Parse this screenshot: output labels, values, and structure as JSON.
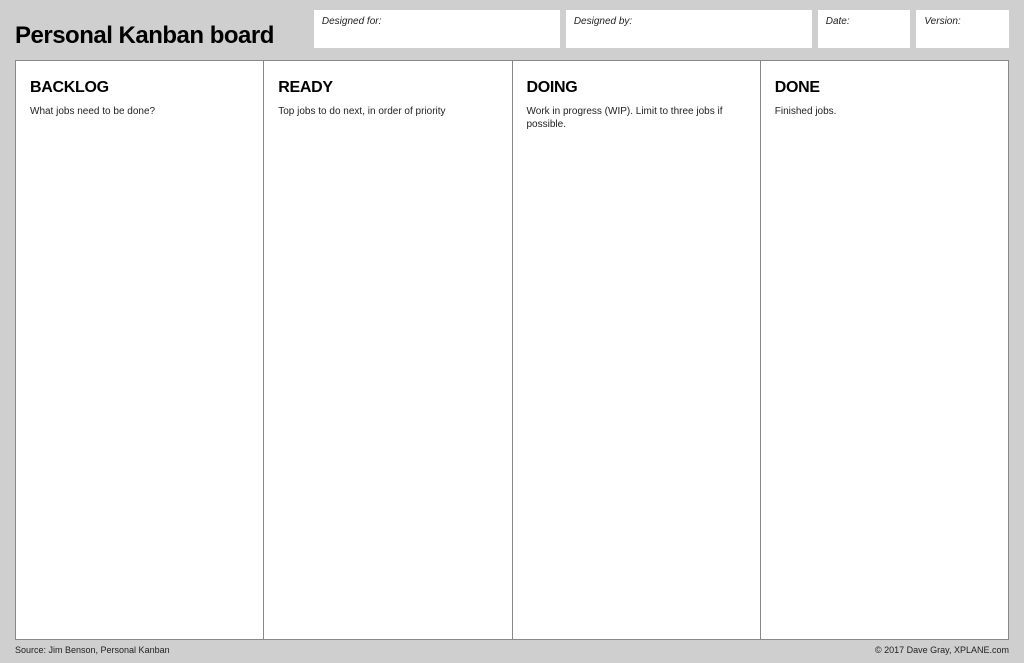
{
  "title": "Personal Kanban board",
  "meta": {
    "designed_for": {
      "label": "Designed for:"
    },
    "designed_by": {
      "label": "Designed by:"
    },
    "date": {
      "label": "Date:"
    },
    "version": {
      "label": "Version:"
    }
  },
  "columns": [
    {
      "title": "BACKLOG",
      "desc": "What jobs need to be done?"
    },
    {
      "title": "READY",
      "desc": "Top jobs to do next, in order of priority"
    },
    {
      "title": "DOING",
      "desc": "Work in progress (WIP). Limit to three jobs if possible."
    },
    {
      "title": "DONE",
      "desc": "Finished jobs."
    }
  ],
  "footer": {
    "source": "Source: Jim Benson, Personal Kanban",
    "copyright": "© 2017 Dave Gray, XPLANE.com"
  }
}
